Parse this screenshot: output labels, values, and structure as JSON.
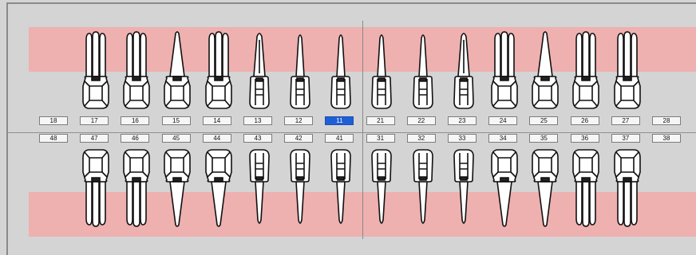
{
  "chart": {
    "selected_tooth": "11",
    "upper_numbers": [
      "18",
      "17",
      "16",
      "15",
      "14",
      "13",
      "12",
      "11",
      "21",
      "22",
      "23",
      "24",
      "25",
      "26",
      "27",
      "28"
    ],
    "lower_numbers": [
      "48",
      "47",
      "46",
      "45",
      "44",
      "43",
      "42",
      "41",
      "31",
      "32",
      "33",
      "34",
      "35",
      "36",
      "37",
      "38"
    ],
    "upper_teeth": [
      {
        "id": "17",
        "kind": "molar"
      },
      {
        "id": "16",
        "kind": "molar"
      },
      {
        "id": "15",
        "kind": "premolar"
      },
      {
        "id": "14",
        "kind": "molar"
      },
      {
        "id": "13",
        "kind": "canine"
      },
      {
        "id": "12",
        "kind": "incisor"
      },
      {
        "id": "11",
        "kind": "incisor"
      },
      {
        "id": "21",
        "kind": "incisor"
      },
      {
        "id": "22",
        "kind": "incisor"
      },
      {
        "id": "23",
        "kind": "canine"
      },
      {
        "id": "24",
        "kind": "molar"
      },
      {
        "id": "25",
        "kind": "premolar"
      },
      {
        "id": "26",
        "kind": "molar"
      },
      {
        "id": "27",
        "kind": "molar"
      }
    ],
    "lower_teeth": [
      {
        "id": "47",
        "kind": "molar"
      },
      {
        "id": "46",
        "kind": "molar"
      },
      {
        "id": "45",
        "kind": "premolar"
      },
      {
        "id": "44",
        "kind": "premolar"
      },
      {
        "id": "43",
        "kind": "incisor"
      },
      {
        "id": "42",
        "kind": "incisor"
      },
      {
        "id": "41",
        "kind": "incisor"
      },
      {
        "id": "31",
        "kind": "incisor"
      },
      {
        "id": "32",
        "kind": "incisor"
      },
      {
        "id": "33",
        "kind": "incisor"
      },
      {
        "id": "34",
        "kind": "premolar"
      },
      {
        "id": "35",
        "kind": "premolar"
      },
      {
        "id": "36",
        "kind": "molar"
      },
      {
        "id": "37",
        "kind": "molar"
      }
    ],
    "colors": {
      "gum": "#efb0b0",
      "selected": "#1f5fd6",
      "panel": "#d4d4d4"
    }
  }
}
